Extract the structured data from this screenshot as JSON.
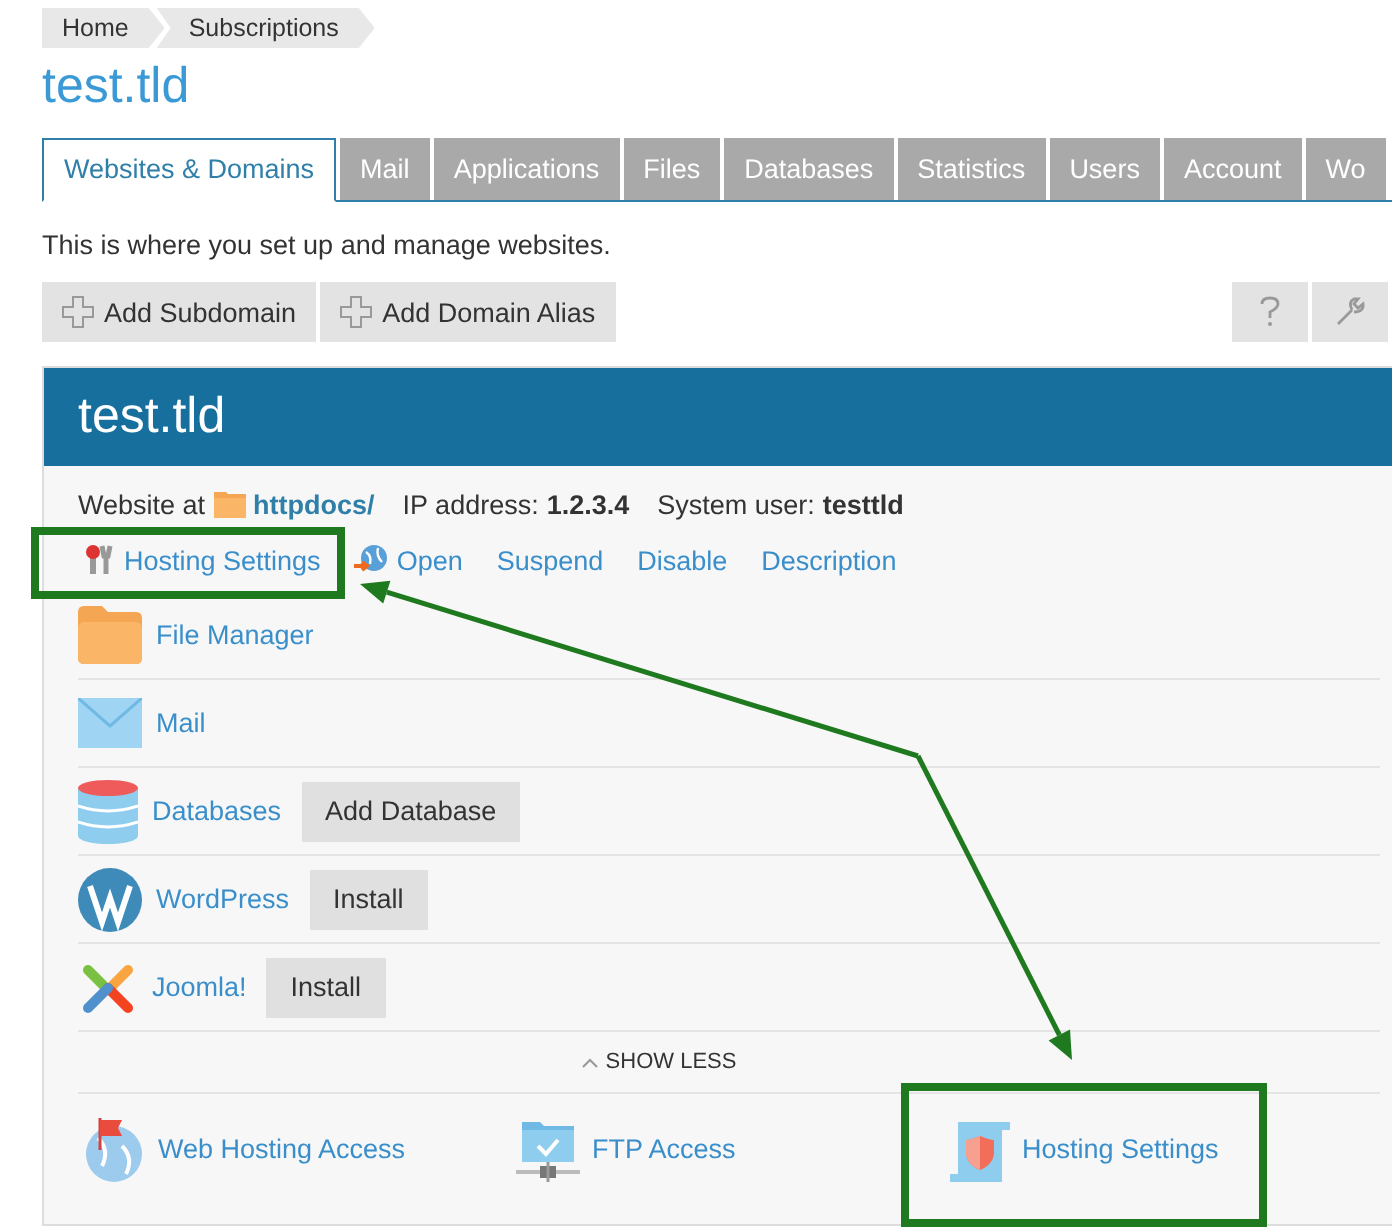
{
  "breadcrumb": [
    {
      "label": "Home"
    },
    {
      "label": "Subscriptions"
    }
  ],
  "title": "test.tld",
  "tabs": [
    {
      "label": "Websites & Domains",
      "selected": true
    },
    {
      "label": "Mail",
      "selected": false
    },
    {
      "label": "Applications",
      "selected": false
    },
    {
      "label": "Files",
      "selected": false
    },
    {
      "label": "Databases",
      "selected": false
    },
    {
      "label": "Statistics",
      "selected": false
    },
    {
      "label": "Users",
      "selected": false
    },
    {
      "label": "Account",
      "selected": false
    },
    {
      "label": "Wo",
      "selected": false
    }
  ],
  "description": "This is where you set up and manage websites.",
  "toolbar": {
    "buttons": [
      {
        "label": "Add Subdomain"
      },
      {
        "label": "Add Domain Alias"
      }
    ]
  },
  "domain_panel": {
    "title": "test.tld",
    "info": {
      "website_label": "Website at",
      "path": "httpdocs/",
      "ip_label": "IP address:",
      "ip": "1.2.3.4",
      "user_label": "System user:",
      "user": "testtld"
    },
    "actions": [
      {
        "label": "Hosting Settings",
        "kind": "settings"
      },
      {
        "label": "Open",
        "kind": "open"
      },
      {
        "label": "Suspend",
        "kind": "plain"
      },
      {
        "label": "Disable",
        "kind": "plain"
      },
      {
        "label": "Description",
        "kind": "plain"
      }
    ],
    "rows": [
      {
        "label": "File Manager",
        "kind": "folder"
      },
      {
        "label": "Mail",
        "kind": "mail"
      },
      {
        "label": "Databases",
        "kind": "database",
        "button": "Add Database"
      },
      {
        "label": "WordPress",
        "kind": "wordpress",
        "button": "Install"
      },
      {
        "label": "Joomla!",
        "kind": "joomla",
        "button": "Install"
      }
    ],
    "toggle": "SHOW LESS",
    "tools": [
      {
        "label": "Web Hosting Access",
        "kind": "globe"
      },
      {
        "label": "FTP Access",
        "kind": "ftp"
      },
      {
        "label": "Hosting Settings",
        "kind": "hosting"
      }
    ]
  }
}
